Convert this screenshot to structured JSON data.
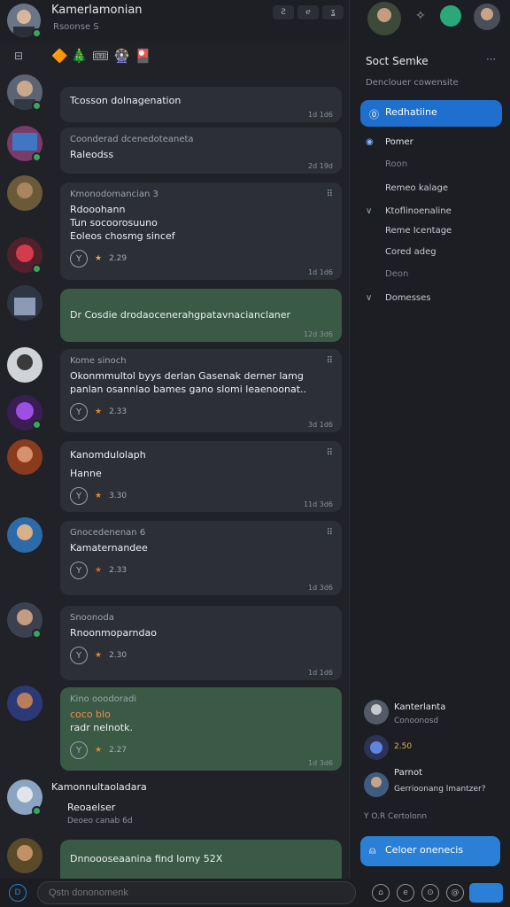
{
  "header": {
    "title": "Kamerlamonian",
    "subtitle": "Rsoonse S",
    "actions": [
      "Ƨ",
      "ℯ",
      "ʓ"
    ]
  },
  "reactions_bar": [
    "🔶",
    "🎄",
    "🎟",
    "🎡",
    "🎴"
  ],
  "messages": [
    {
      "author": "",
      "text": "Tcosson dolnagenation",
      "time": "1d 1d6",
      "style": "normal",
      "reactions": []
    },
    {
      "author": "Coonderad dcenedoteaneta",
      "text": "Raleodss",
      "time": "2d 19d",
      "style": "normal",
      "reactions": []
    },
    {
      "author": "Kmonodomancian 3",
      "text": "Rdooohann",
      "text2": "Tun socoorosuuno",
      "text3": "Eoleos chosmg sincef",
      "time": "1d 1d6",
      "style": "normal",
      "reactions": [
        "2.29"
      ]
    },
    {
      "author": "",
      "text": "Dr Cosdie drodaocenerahgpatavnacianclaner",
      "time": "12d 3d6",
      "style": "green",
      "reactions": []
    },
    {
      "author": "Kome sinoch",
      "text": "Okonmmultol byys derlan Gasenak derner lamg",
      "text2": "panlan osannlao bames gano slomi leaenoonat..",
      "time": "3d 1d6",
      "style": "normal",
      "reactions": [
        "2.33"
      ]
    },
    {
      "author": "",
      "text": "Kanomdulolaph",
      "text2": "Hanne",
      "time": "11d 3d6",
      "style": "normal",
      "reactions": [
        "3.30"
      ]
    },
    {
      "author": "Gnocedenenan 6",
      "text": "Kamaternandee",
      "time": "1d 3d6",
      "style": "normal",
      "reactions": [
        "2.33"
      ]
    },
    {
      "author": "Snoonoda",
      "text": "Rnoonmoparndao",
      "time": "1d 1d6",
      "style": "normal",
      "reactions": [
        "2.30"
      ]
    },
    {
      "author": "Kino ooodoradi",
      "text": "coco blo",
      "text2": "radr nelnotk.",
      "time": "1d 3d6",
      "style": "green",
      "reactions": [
        "2.27"
      ]
    },
    {
      "author": "Kamonnultaoladara",
      "text": "Reoaelser",
      "text2": "Deoeo canab 6d",
      "time": "",
      "style": "normal",
      "reactions": []
    },
    {
      "author": "",
      "text": "Dnnoooseaanina find lomy 52X",
      "time": "",
      "style": "green",
      "reactions": []
    }
  ],
  "composer": {
    "placeholder": "Qstn dononomenk"
  },
  "sidebar": {
    "title": "Soct Semke",
    "subtitle": "Denclouer cowensite",
    "active_item": "Redhatiine",
    "section": "Pomer",
    "items": [
      "Roon",
      "Remeo kalage",
      "Ktoflinoenaline",
      "Reme Icentage",
      "Cored adeg",
      "Deon",
      "Domesses"
    ],
    "card_name": "Kanterlanta",
    "card_sub": "Conoonosd",
    "card_count": "2.50",
    "card2_name": "Parnot",
    "card2_sub": "Gerrioonang lmantzer?",
    "footer_text": "Y O.R Certolonn",
    "cta": "Celoer onenecis"
  },
  "colors": {
    "accent": "#1f6fcf",
    "online": "#3ba55d",
    "green_bubble": "#3a5a45"
  }
}
